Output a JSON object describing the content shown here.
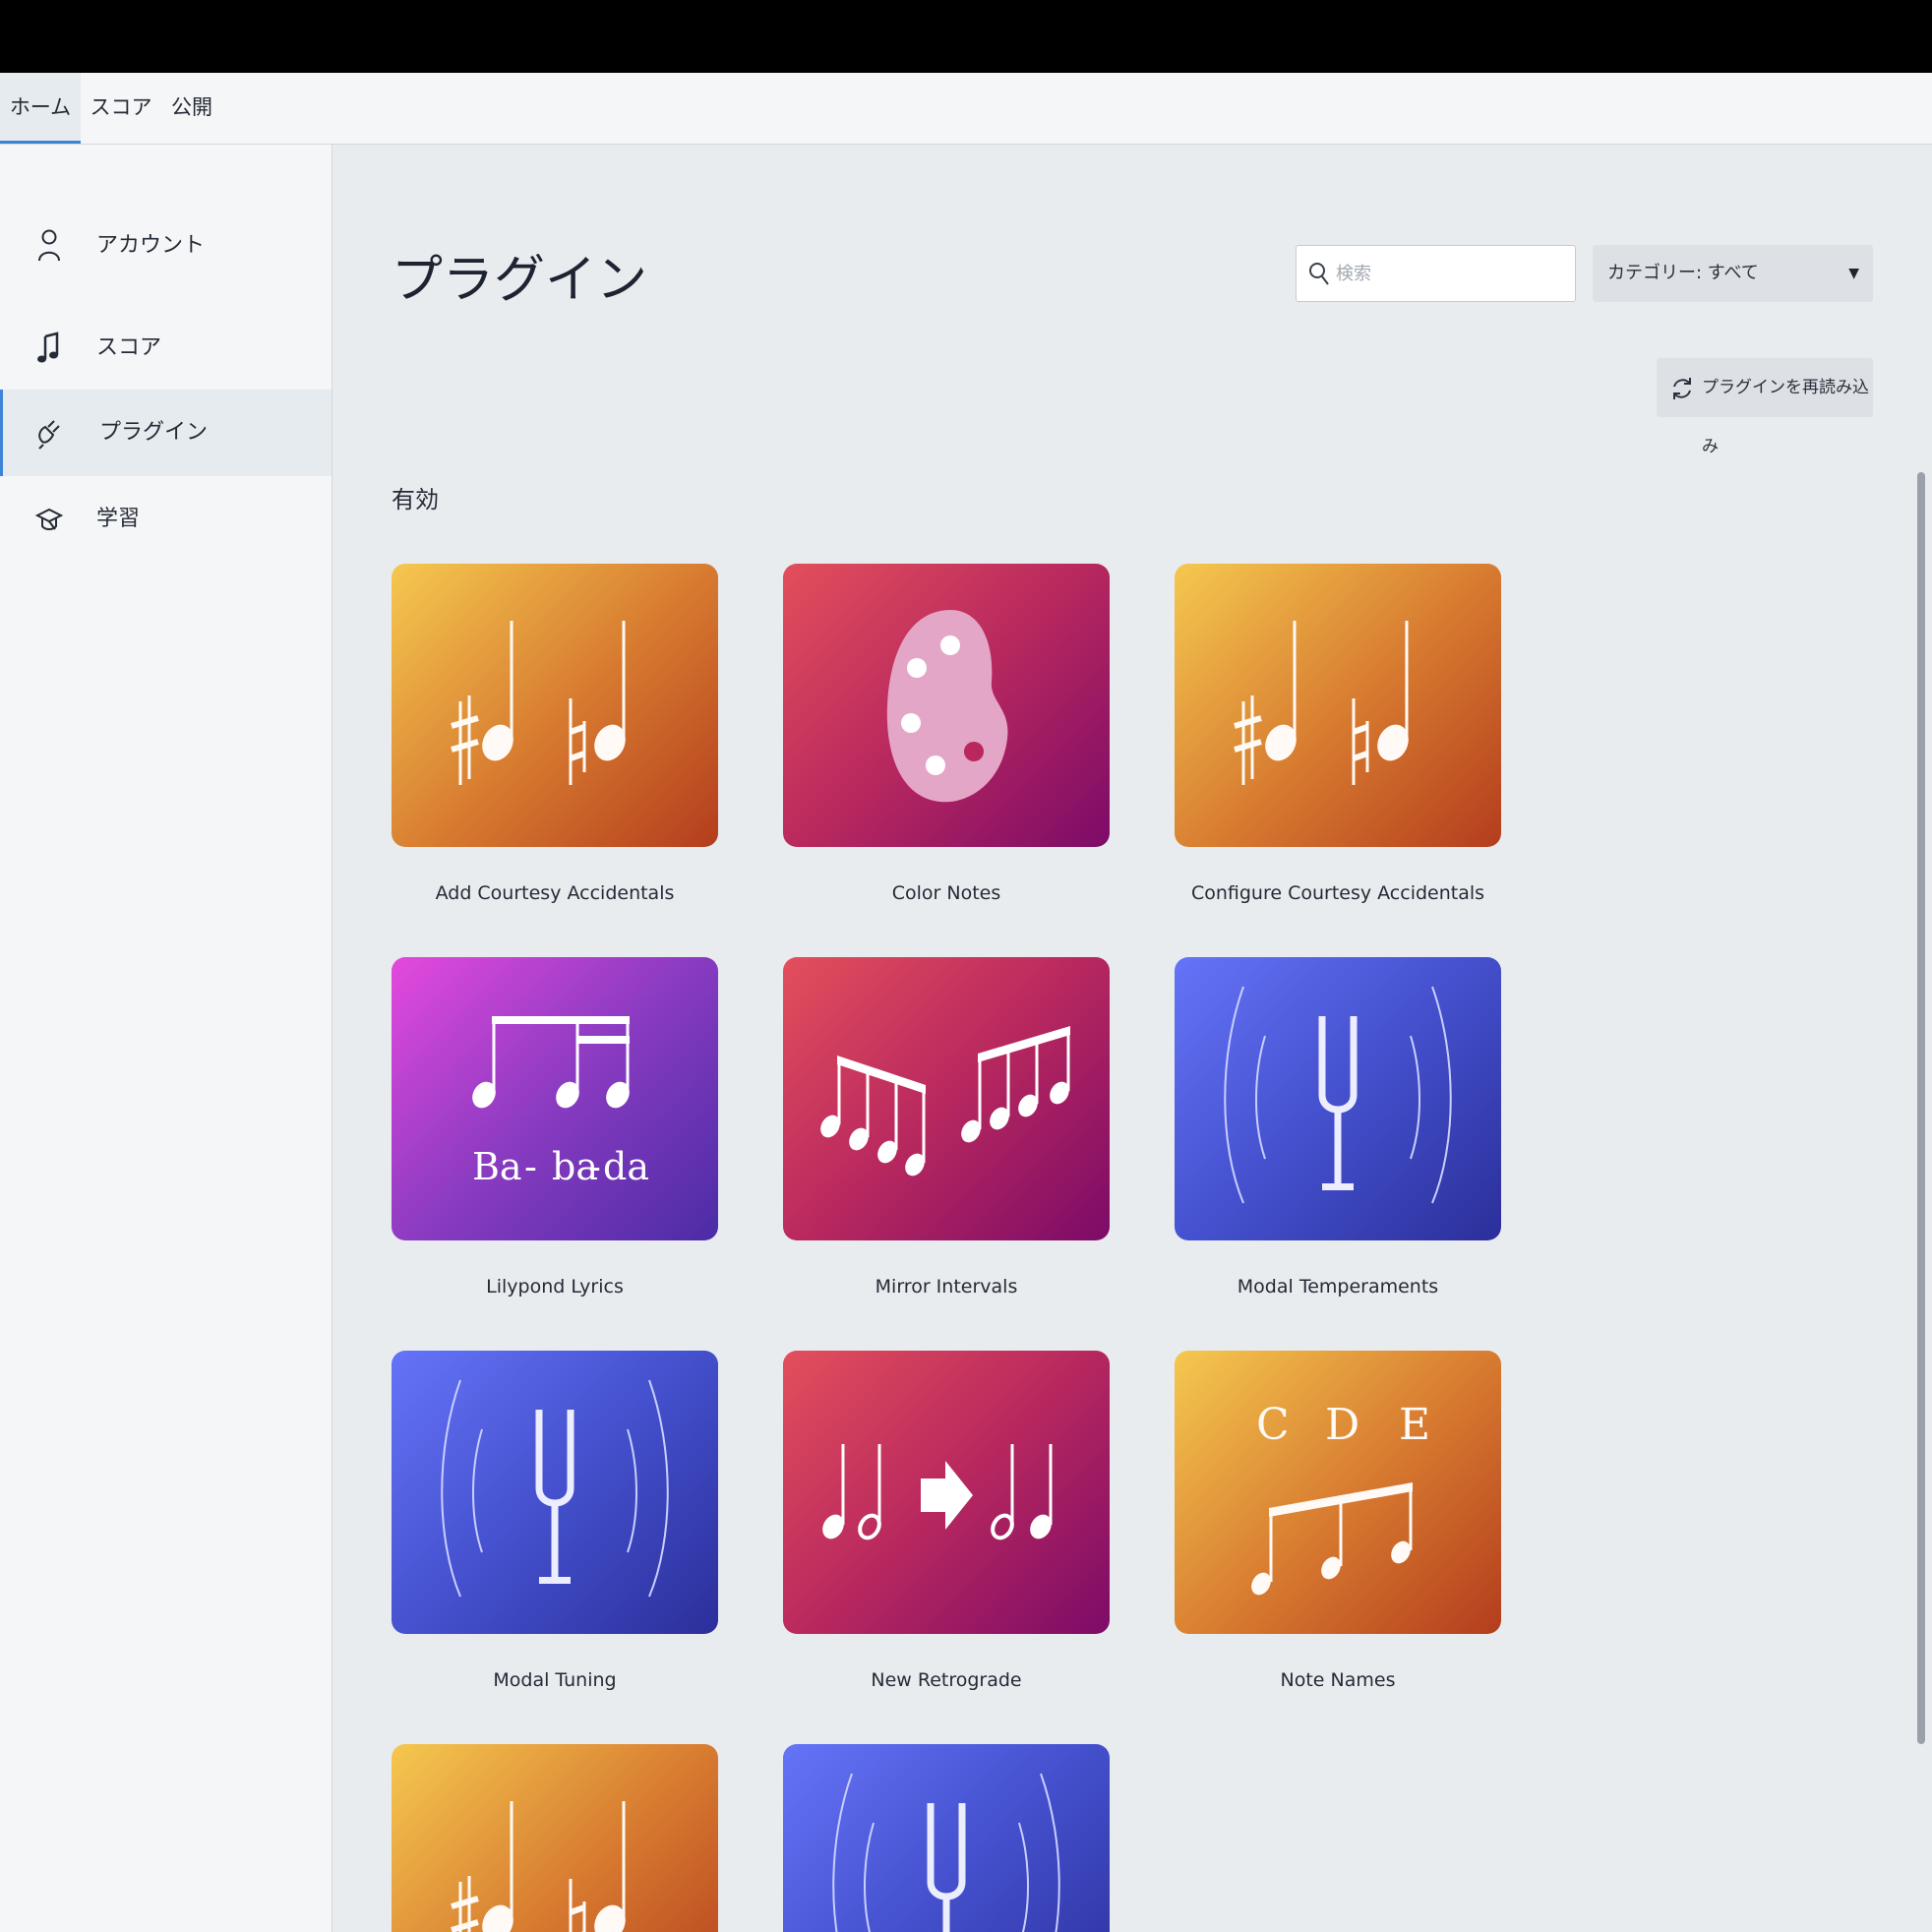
{
  "tabs": [
    {
      "label": "ホーム",
      "active": true
    },
    {
      "label": "スコア",
      "active": false
    },
    {
      "label": "公開",
      "active": false
    }
  ],
  "sidebar": {
    "items": [
      {
        "label": "アカウント",
        "icon": "account-icon",
        "active": false
      },
      {
        "label": "スコア",
        "icon": "music-note-icon",
        "active": false
      },
      {
        "label": "プラグイン",
        "icon": "plug-icon",
        "active": true
      },
      {
        "label": "学習",
        "icon": "learn-icon",
        "active": false
      }
    ]
  },
  "main": {
    "title": "プラグイン",
    "search": {
      "placeholder": "検索",
      "value": ""
    },
    "category": {
      "label": "カテゴリー: すべて"
    },
    "reload_label": "プラグインを再読み込み",
    "section_title": "有効",
    "plugins": [
      {
        "name": "Add Courtesy Accidentals",
        "thumbnail": "accidentals-icon",
        "color": "#d6782f"
      },
      {
        "name": "Color Notes",
        "thumbnail": "palette-icon",
        "color": "#b8285e"
      },
      {
        "name": "Configure Courtesy Accidentals",
        "thumbnail": "accidentals-icon",
        "color": "#d6782f"
      },
      {
        "name": "Lilypond Lyrics",
        "thumbnail": "lyrics-icon",
        "color": "#8a3bc1",
        "text": [
          "Ba",
          "-",
          "ba",
          "-",
          "da"
        ]
      },
      {
        "name": "Mirror Intervals",
        "thumbnail": "mirror-notes-icon",
        "color": "#b8285e"
      },
      {
        "name": "Modal Temperaments",
        "thumbnail": "tuning-fork-icon",
        "color": "#4450cd"
      },
      {
        "name": "Modal Tuning",
        "thumbnail": "tuning-fork-icon",
        "color": "#4450cd"
      },
      {
        "name": "New Retrograde",
        "thumbnail": "retrograde-icon",
        "color": "#b8285e"
      },
      {
        "name": "Note Names",
        "thumbnail": "note-names-icon",
        "color": "#d6782f",
        "text": [
          "C",
          "D",
          "E"
        ]
      },
      {
        "name": "",
        "thumbnail": "accidentals-icon",
        "color": "#d6782f"
      },
      {
        "name": "",
        "thumbnail": "tuning-fork-icon",
        "color": "#4450cd"
      }
    ]
  }
}
